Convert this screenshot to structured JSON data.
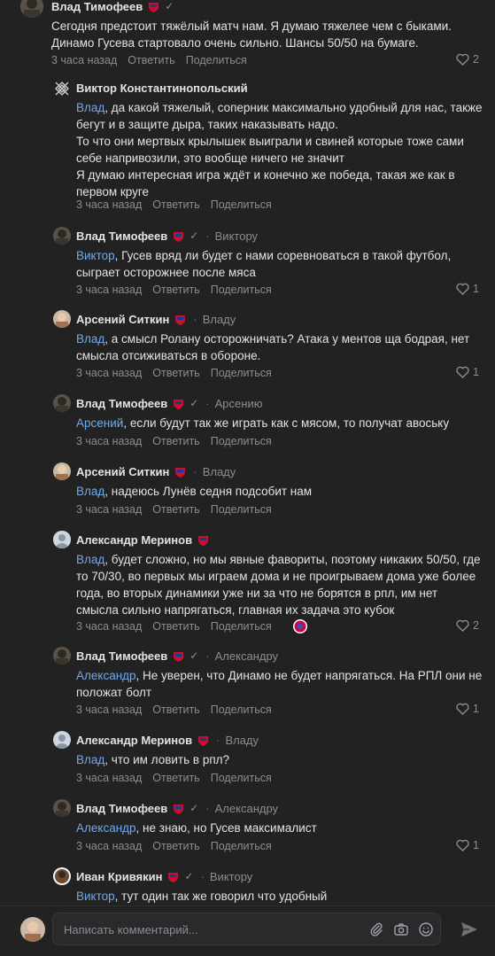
{
  "comments": [
    {
      "author": "Влад Тимофеев",
      "text": "Сегодня предстоит тяжёлый матч нам. Я думаю тяжелее чем с быками. Динамо Гусева стартовало очень сильно. Шансы 50/50 на бумаге.",
      "time": "3 часа назад",
      "reply": "Ответить",
      "share": "Поделиться",
      "likes": "2"
    },
    {
      "author": "Виктор Константинопольский",
      "mention": "Влад",
      "text": ", да какой тяжелый, соперник максимально удобный для нас, также бегут и в защите дыра, таких наказывать надо.",
      "text2": "То что они мертвых крылышек выиграли и свиней которые тоже сами себе напривозили, это вообще ничего не значит",
      "text3": "Я думаю интересная игра ждёт и конечно же победа, такая же как в первом круге",
      "time": "3 часа назад",
      "reply": "Ответить",
      "share": "Поделиться"
    },
    {
      "author": "Влад Тимофеев",
      "to": "Виктору",
      "mention": "Виктор",
      "text": ", Гусев вряд ли будет с нами соревноваться в такой футбол, сыграет осторожнее после мяса",
      "time": "3 часа назад",
      "reply": "Ответить",
      "share": "Поделиться",
      "likes": "1"
    },
    {
      "author": "Арсений Ситкин",
      "to": "Владу",
      "mention": "Влад",
      "text": ", а смысл Ролану осторожничать? Атака у ментов ща бодрая, нет смысла отсиживаться в обороне.",
      "time": "3 часа назад",
      "reply": "Ответить",
      "share": "Поделиться",
      "likes": "1"
    },
    {
      "author": "Влад Тимофеев",
      "to": "Арсению",
      "mention": "Арсений",
      "text": ", если будут так же играть как с мясом, то получат авоську",
      "time": "3 часа назад",
      "reply": "Ответить",
      "share": "Поделиться"
    },
    {
      "author": "Арсений Ситкин",
      "to": "Владу",
      "mention": "Влад",
      "text": ", надеюсь Лунёв седня подсобит нам",
      "time": "3 часа назад",
      "reply": "Ответить",
      "share": "Поделиться"
    },
    {
      "author": "Александр Меринов",
      "mention": "Влад",
      "text": ", будет сложно, но мы явные фавориты, поэтому никаких 50/50, где то 70/30, во первых мы играем дома и не проигрываем дома уже более года, во вторых динамики уже ни за что не борятся в рпл, им нет смысла сильно напрягаться, главная их задача это кубок",
      "time": "3 часа назад",
      "reply": "Ответить",
      "share": "Поделиться",
      "likes": "2"
    },
    {
      "author": "Влад Тимофеев",
      "to": "Александру",
      "mention": "Александр",
      "text": ", Не уверен, что Динамо не будет напрягаться. На РПЛ они не положат болт",
      "time": "3 часа назад",
      "reply": "Ответить",
      "share": "Поделиться",
      "likes": "1"
    },
    {
      "author": "Александр Меринов",
      "to": "Владу",
      "mention": "Влад",
      "text": ", что им ловить в рпл?",
      "time": "3 часа назад",
      "reply": "Ответить",
      "share": "Поделиться"
    },
    {
      "author": "Влад Тимофеев",
      "to": "Александру",
      "mention": "Александр",
      "text": ", не знаю, но Гусев максималист",
      "time": "3 часа назад",
      "reply": "Ответить",
      "share": "Поделиться",
      "likes": "1"
    },
    {
      "author": "Иван Кривякин",
      "to": "Виктору",
      "mention": "Виктор",
      "text": ", тут один так же говорил что удобный"
    }
  ],
  "composer": {
    "placeholder": "Написать комментарий...",
    "icons": [
      "paperclip-icon",
      "camera-icon",
      "emoji-icon",
      "send-icon"
    ]
  },
  "colors": {
    "background": "#222222",
    "mention": "#71aaeb",
    "muted": "#8a8d91",
    "text": "#e1e3e6",
    "badge": "#c8102e"
  }
}
